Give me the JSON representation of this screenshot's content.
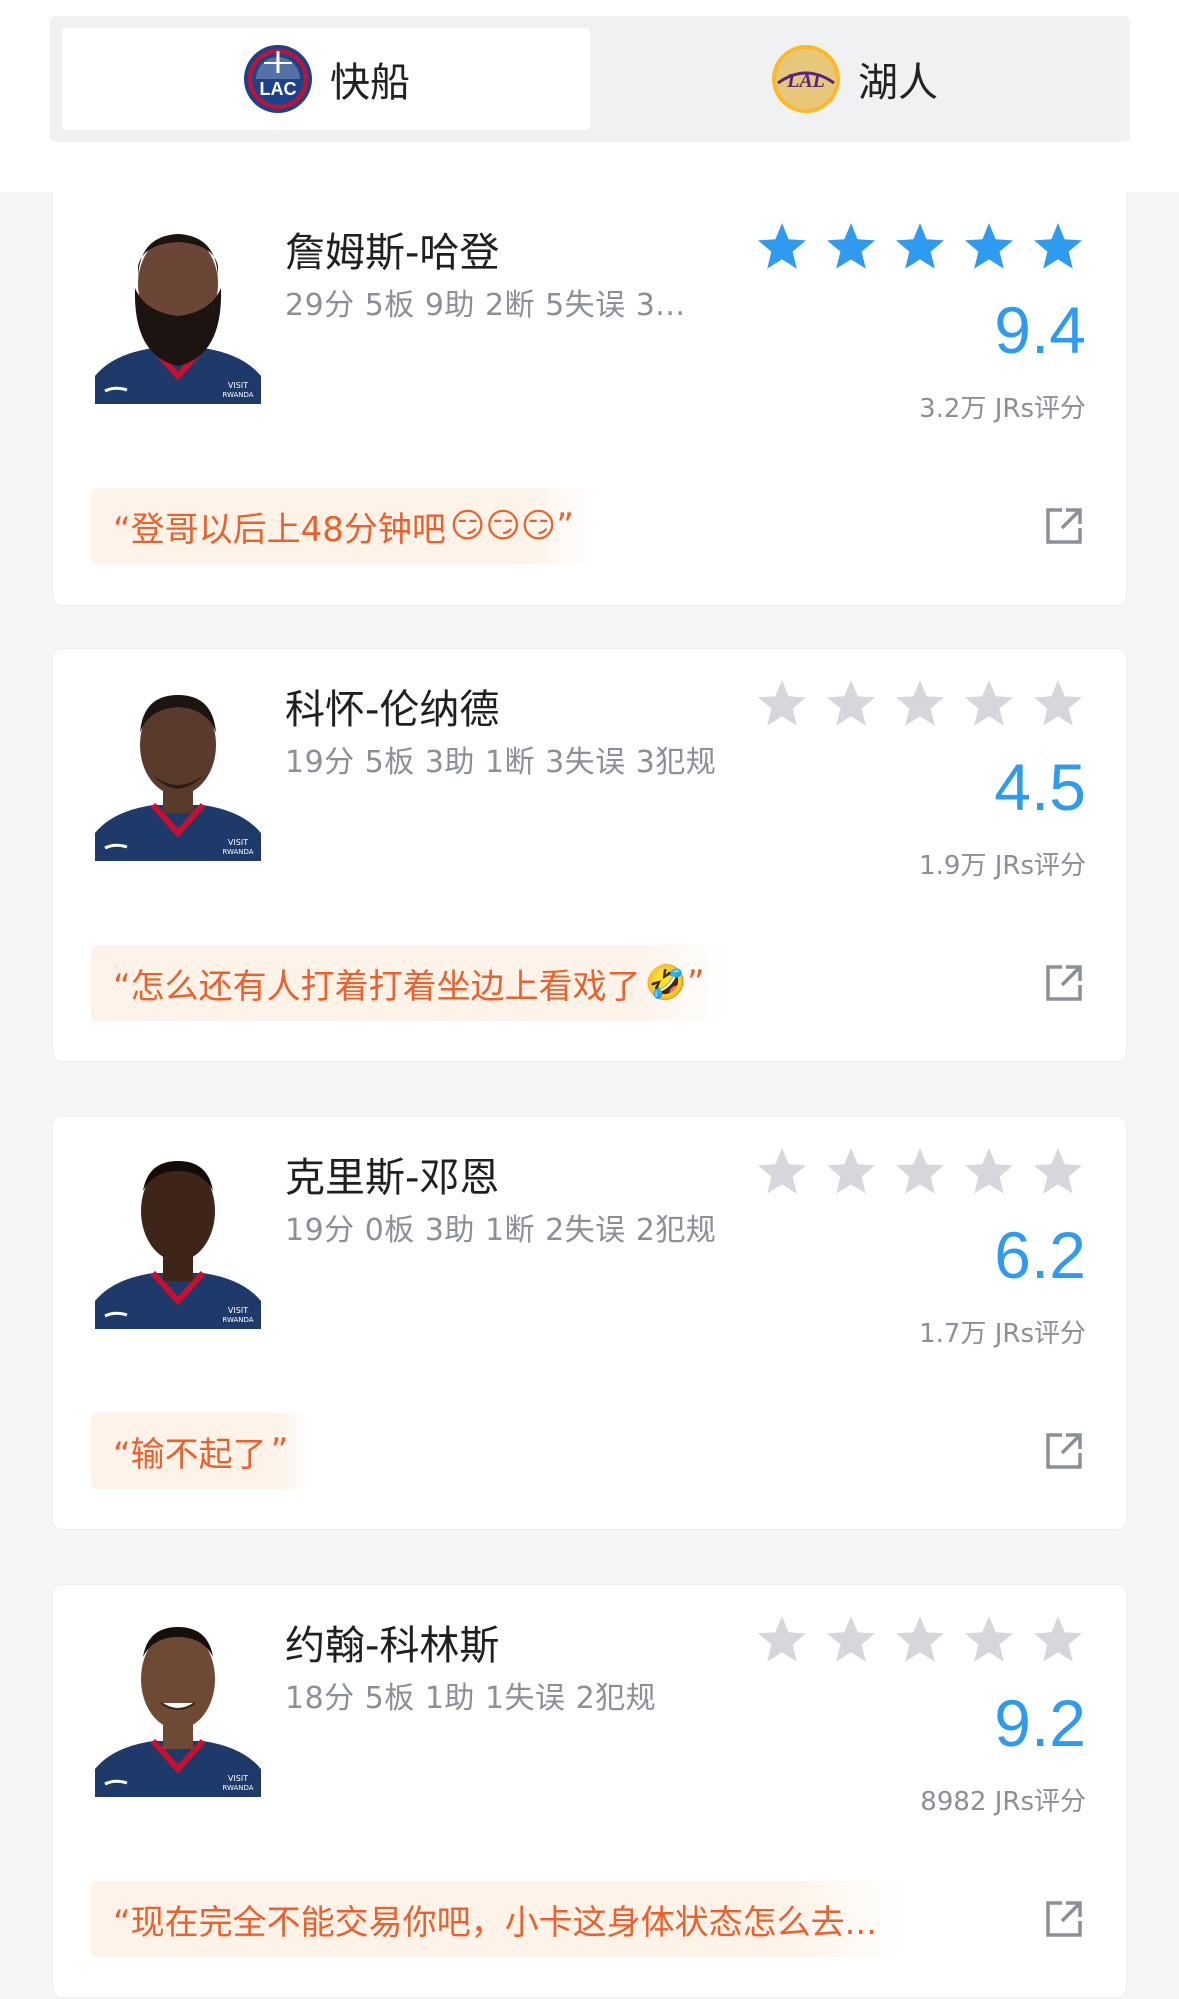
{
  "tabs": [
    {
      "label": "快船",
      "logo": "clippers-logo",
      "active": true
    },
    {
      "label": "湖人",
      "logo": "lakers-logo",
      "active": false
    }
  ],
  "colors": {
    "accent": "#2f9bf0",
    "quote_text": "#ef5f2c",
    "quote_bg": "#fdf3e8",
    "star_filled": "#2f9bf0",
    "star_empty": "#d5d7dc"
  },
  "players": [
    {
      "name": "詹姆斯-哈登",
      "stats": "29分 5板 9助 2断 5失误 3...",
      "stars_filled": 5,
      "score": "9.4",
      "raters": "3.2万 JRs评分",
      "quote": "“登哥以后上48分钟吧",
      "quote_emoji": "😏😏😏",
      "quote_end": "”"
    },
    {
      "name": "科怀-伦纳德",
      "stats": "19分 5板 3助 1断 3失误 3犯规",
      "stars_filled": 0,
      "score": "4.5",
      "raters": "1.9万 JRs评分",
      "quote": "“怎么还有人打着打着坐边上看戏了",
      "quote_emoji": "🤣",
      "quote_end": "”"
    },
    {
      "name": "克里斯-邓恩",
      "stats": "19分 0板 3助 1断 2失误 2犯规",
      "stars_filled": 0,
      "score": "6.2",
      "raters": "1.7万 JRs评分",
      "quote": "“输不起了",
      "quote_emoji": "",
      "quote_end": "”"
    },
    {
      "name": "约翰-科林斯",
      "stats": "18分 5板 1助 1失误 2犯规",
      "stars_filled": 0,
      "score": "9.2",
      "raters": "8982 JRs评分",
      "quote": "“现在完全不能交易你吧，小卡这身体状态怎么去...",
      "quote_emoji": "",
      "quote_end": ""
    }
  ]
}
